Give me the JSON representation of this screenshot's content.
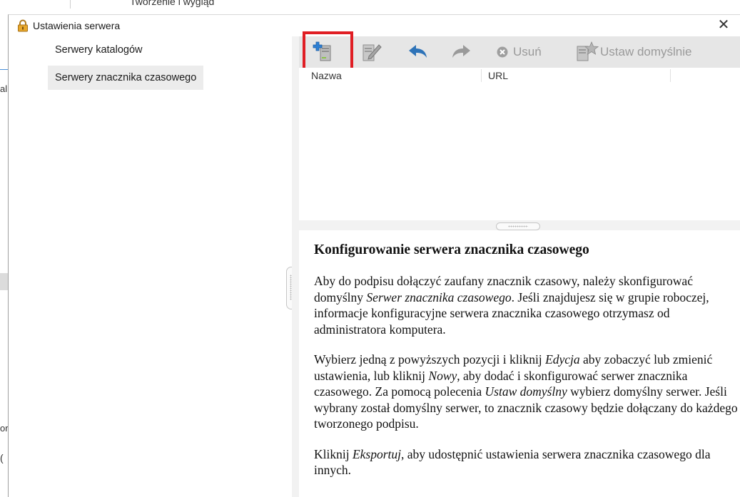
{
  "background": {
    "tab_text": "Tworzenie i wygląd",
    "left_letter_1": "al",
    "left_letter_2": "or",
    "left_letter_3": "("
  },
  "dialog": {
    "title": "Ustawienia serwera",
    "title_icon": "lock-icon",
    "close_icon": "close-icon",
    "close_glyph": "✕"
  },
  "sidebar": {
    "items": [
      {
        "label": "Serwery katalogów",
        "selected": false
      },
      {
        "label": "Serwery znacznika czasowego",
        "selected": true
      }
    ]
  },
  "toolbar": {
    "new_icon": "new-server-icon",
    "edit_icon": "edit-icon",
    "import_icon": "import-arrow-icon",
    "export_icon": "export-arrow-icon",
    "delete_label": "Usuń",
    "delete_icon": "delete-circle-x-icon",
    "set_default_label": "Ustaw domyślnie",
    "set_default_icon": "star-document-icon",
    "highlight_color": "#e01e24"
  },
  "table": {
    "columns": [
      "Nazwa",
      "URL"
    ],
    "rows": []
  },
  "help": {
    "heading": "Konfigurowanie serwera znacznika czasowego",
    "p1_a": "Aby do podpisu dołączyć zaufany znacznik czasowy, należy skonfigurować domyślny ",
    "p1_em": "Serwer znacznika czasowego",
    "p1_b": ". Jeśli znajdujesz się w grupie roboczej, informacje konfiguracyjne serwera znacznika czasowego otrzymasz od administratora komputera.",
    "p2_a": "Wybierz jedną z powyższych pozycji i kliknij ",
    "p2_em1": "Edycja",
    "p2_b": " aby zobaczyć lub zmienić ustawienia, lub kliknij ",
    "p2_em2": "Nowy",
    "p2_c": ", aby dodać i skonfigurować serwer znacznika czasowego. Za pomocą polecenia ",
    "p2_em3": "Ustaw domyślny",
    "p2_d": " wybierz domyślny serwer. Jeśli wybrany został domyślny serwer, to znacznik czasowy będzie dołączany do każdego tworzonego podpisu.",
    "p3_a": "Kliknij ",
    "p3_em": "Eksportuj",
    "p3_b": ", aby udostępnić ustawienia serwera znacznika czasowego dla innych."
  }
}
